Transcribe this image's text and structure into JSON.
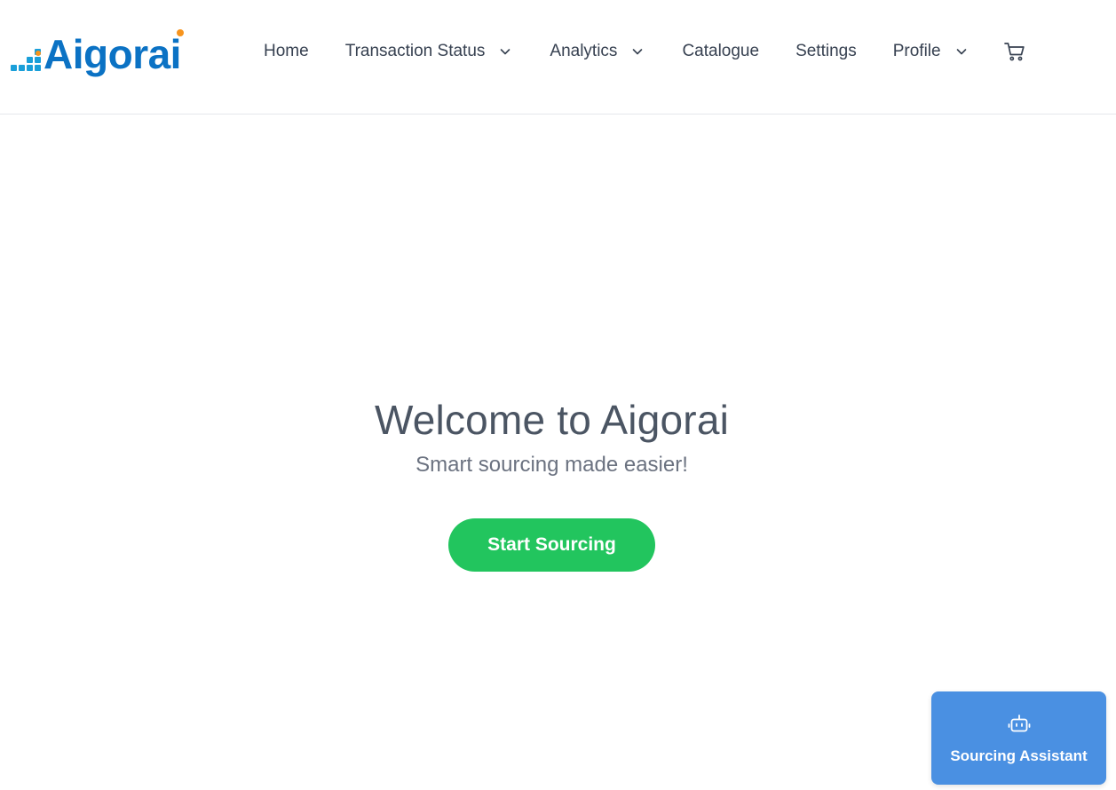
{
  "brand": {
    "name": "Aigorai",
    "primary_color": "#0b72c4",
    "accent_color": "#f7941d",
    "mark_color": "#1a9fd9"
  },
  "nav": {
    "items": [
      {
        "label": "Home",
        "has_dropdown": false
      },
      {
        "label": "Transaction Status",
        "has_dropdown": true
      },
      {
        "label": "Analytics",
        "has_dropdown": true
      },
      {
        "label": "Catalogue",
        "has_dropdown": false
      },
      {
        "label": "Settings",
        "has_dropdown": false
      },
      {
        "label": "Profile",
        "has_dropdown": true
      }
    ],
    "cart_icon": "cart-icon",
    "dropdown_icon": "chevron-down-icon"
  },
  "hero": {
    "title": "Welcome to Aigorai",
    "subtitle": "Smart sourcing made easier!",
    "cta_label": "Start Sourcing",
    "cta_color": "#22c55e"
  },
  "assistant": {
    "label": "Sourcing Assistant",
    "icon": "robot-icon",
    "color": "#4a90e2"
  }
}
